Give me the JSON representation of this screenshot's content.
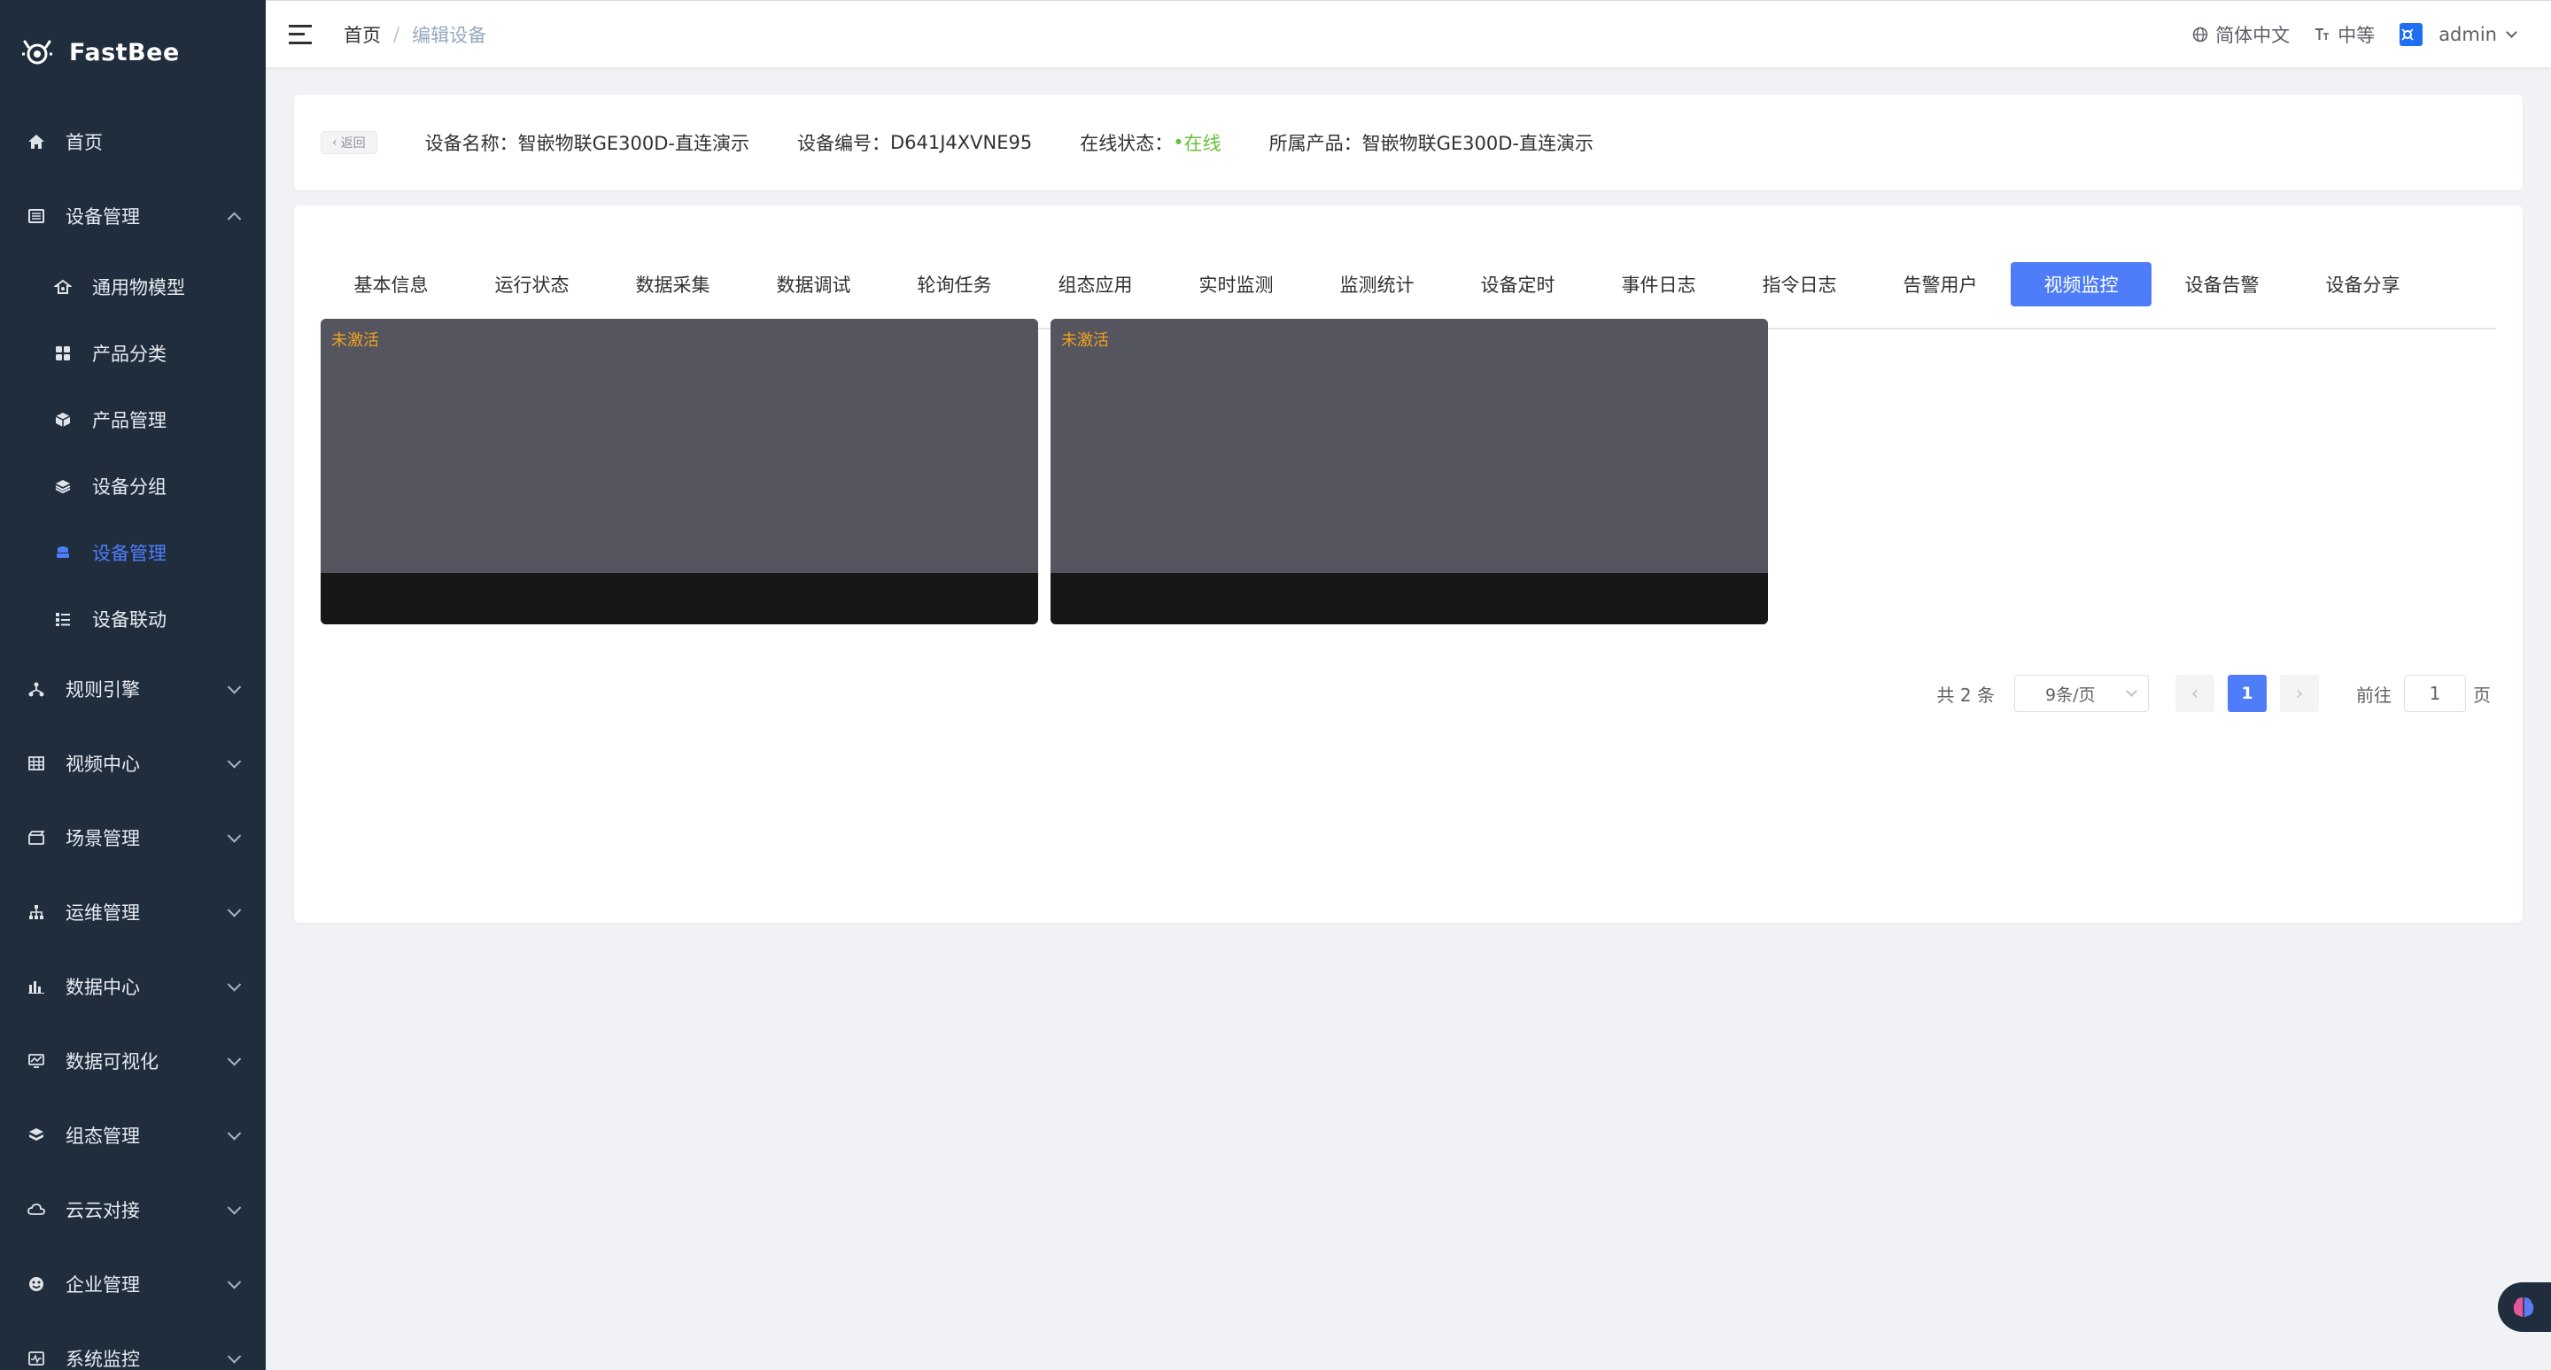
{
  "app": {
    "name": "FastBee"
  },
  "sidebar": {
    "items": [
      {
        "label": "首页",
        "icon": "home-icon"
      },
      {
        "label": "设备管理",
        "icon": "device-icon",
        "expanded": true,
        "children": [
          {
            "label": "通用物模型",
            "icon": "model-icon"
          },
          {
            "label": "产品分类",
            "icon": "category-icon"
          },
          {
            "label": "产品管理",
            "icon": "product-icon"
          },
          {
            "label": "设备分组",
            "icon": "group-icon"
          },
          {
            "label": "设备管理",
            "icon": "device-manage-icon",
            "active": true
          },
          {
            "label": "设备联动",
            "icon": "linkage-icon"
          }
        ]
      },
      {
        "label": "规则引擎",
        "icon": "rule-icon"
      },
      {
        "label": "视频中心",
        "icon": "video-icon"
      },
      {
        "label": "场景管理",
        "icon": "scene-icon"
      },
      {
        "label": "运维管理",
        "icon": "ops-icon"
      },
      {
        "label": "数据中心",
        "icon": "data-icon"
      },
      {
        "label": "数据可视化",
        "icon": "visual-icon"
      },
      {
        "label": "组态管理",
        "icon": "config-icon"
      },
      {
        "label": "云云对接",
        "icon": "cloud-icon"
      },
      {
        "label": "企业管理",
        "icon": "enterprise-icon"
      },
      {
        "label": "系统监控",
        "icon": "monitor-icon"
      }
    ]
  },
  "navbar": {
    "breadcrumb": {
      "home": "首页",
      "separator": "/",
      "current": "编辑设备"
    },
    "language": "简体中文",
    "font_size": "中等",
    "user": "admin"
  },
  "header": {
    "back_label": "返回",
    "device_name_label": "设备名称：",
    "device_name": "智嵌物联GE300D-直连演示",
    "device_no_label": "设备编号：",
    "device_no": "D641J4XVNE95",
    "status_label": "在线状态：",
    "status_dot": "•",
    "status_value": "在线",
    "product_label": "所属产品：",
    "product": "智嵌物联GE300D-直连演示"
  },
  "tabs": [
    "基本信息",
    "运行状态",
    "数据采集",
    "数据调试",
    "轮询任务",
    "组态应用",
    "实时监测",
    "监测统计",
    "设备定时",
    "事件日志",
    "指令日志",
    "告警用户",
    "视频监控",
    "设备告警",
    "设备分享"
  ],
  "active_tab": "视频监控",
  "videos": [
    {
      "status": "未激活"
    },
    {
      "status": "未激活"
    }
  ],
  "pagination": {
    "total": "共 2 条",
    "page_size": "9条/页",
    "current_page": "1",
    "goto_prefix": "前往",
    "goto_value": "1",
    "goto_suffix": "页"
  },
  "colors": {
    "primary": "#4f7dfa",
    "sidebar_bg": "#1f2d3d",
    "online": "#67c23a",
    "inactive": "#f0a020"
  }
}
